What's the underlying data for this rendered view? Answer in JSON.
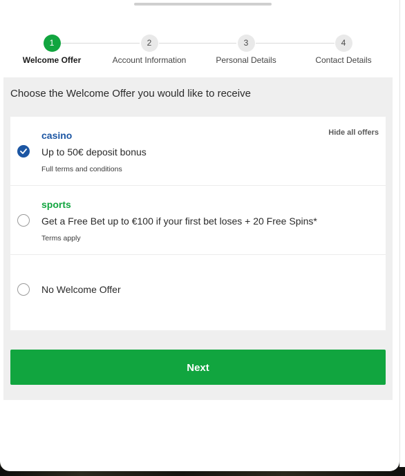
{
  "stepper": {
    "steps": [
      {
        "number": "1",
        "label": "Welcome Offer",
        "active": true
      },
      {
        "number": "2",
        "label": "Account Information",
        "active": false
      },
      {
        "number": "3",
        "label": "Personal Details",
        "active": false
      },
      {
        "number": "4",
        "label": "Contact Details",
        "active": false
      }
    ]
  },
  "panel": {
    "title": "Choose the Welcome Offer you would like to receive",
    "hide_offers_label": "Hide all offers",
    "offers": [
      {
        "brand": "casino",
        "brand_color": "#1c56a3",
        "description": "Up to 50€ deposit bonus",
        "terms": "Full terms and conditions",
        "selected": true
      },
      {
        "brand": "sports",
        "brand_color": "#11a53f",
        "description": "Get a Free Bet up to €100 if your first bet loses + 20 Free Spins*",
        "terms": "Terms apply",
        "selected": false
      },
      {
        "brand": "",
        "description": "No Welcome Offer",
        "terms": "",
        "selected": false
      }
    ]
  },
  "footer": {
    "next_label": "Next"
  },
  "colors": {
    "accent_green": "#11a53f",
    "accent_blue": "#1c56a3"
  }
}
